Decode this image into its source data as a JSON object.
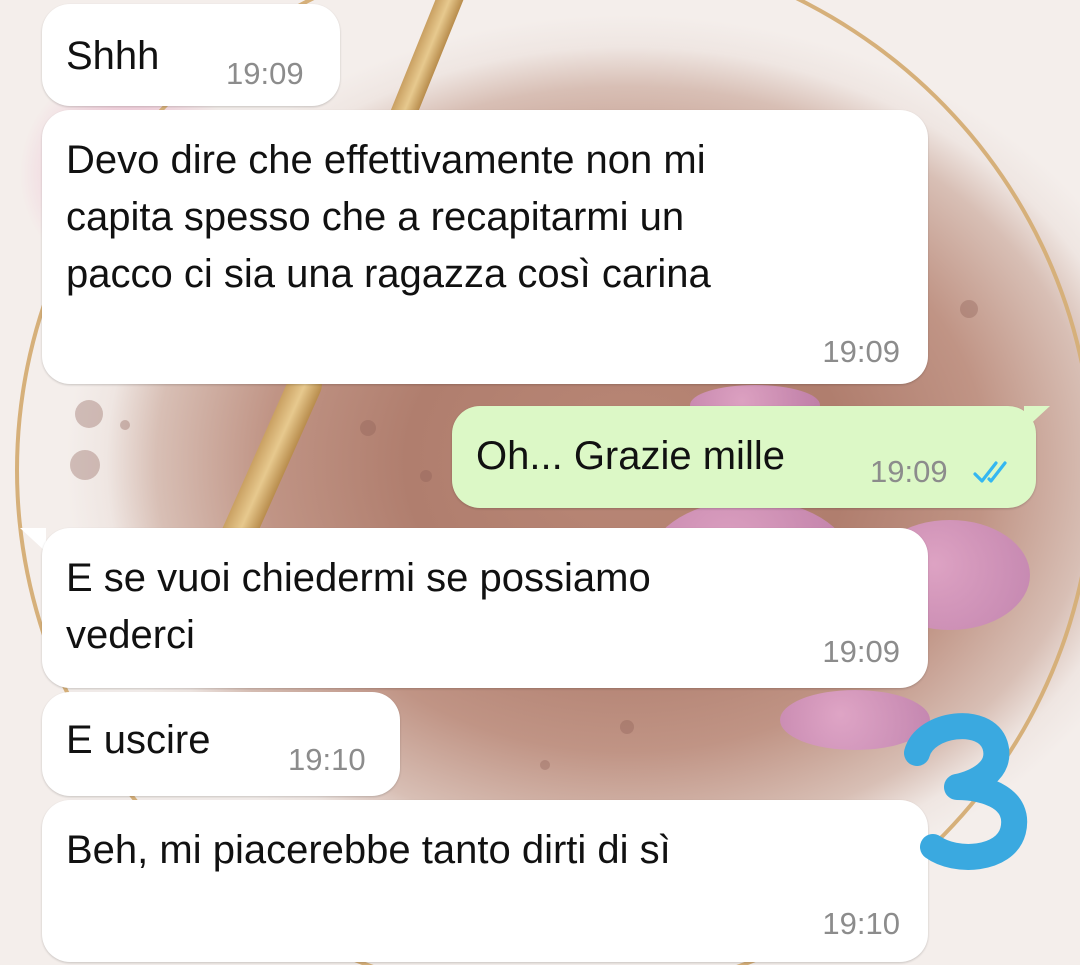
{
  "messages": [
    {
      "direction": "incoming",
      "text": "Shhh",
      "time": "19:09"
    },
    {
      "direction": "incoming",
      "text": "Devo dire che effettivamente non mi\ncapita spesso che a recapitarmi un\npacco ci sia una ragazza così carina",
      "time": "19:09"
    },
    {
      "direction": "outgoing",
      "text": "Oh... Grazie mille",
      "time": "19:09",
      "status": "read"
    },
    {
      "direction": "incoming",
      "text": "E se vuoi chiedermi se possiamo\nvederci",
      "time": "19:09"
    },
    {
      "direction": "incoming",
      "text": "E uscire",
      "time": "19:10"
    },
    {
      "direction": "incoming",
      "text": "Beh, mi piacerebbe tanto dirti di sì",
      "time": "19:10"
    }
  ],
  "icons": {
    "read_receipt": "double-check-icon"
  },
  "colors": {
    "incoming_bubble": "#ffffff",
    "outgoing_bubble": "#dcf8c6",
    "timestamp": "#8c8c8c",
    "read_receipt": "#34b7f1",
    "annotation": "#3aa9e0"
  },
  "annotation": {
    "label": "3"
  }
}
